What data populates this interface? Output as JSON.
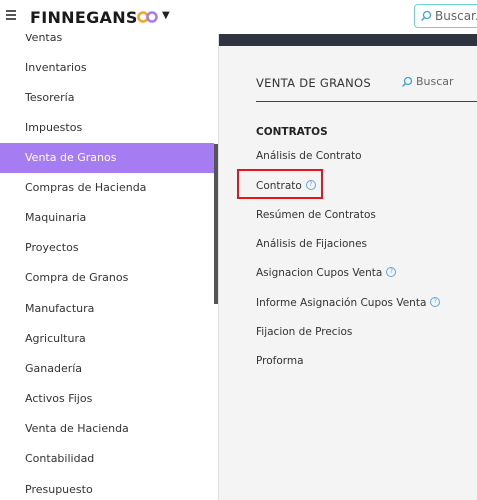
{
  "header": {
    "brand": "FINNEGANS",
    "search_placeholder": "Buscar..."
  },
  "sidebar": {
    "items": [
      {
        "label": "Ventas"
      },
      {
        "label": "Inventarios"
      },
      {
        "label": "Tesorería"
      },
      {
        "label": "Impuestos"
      },
      {
        "label": "Venta de Granos",
        "active": true
      },
      {
        "label": "Compras de Hacienda"
      },
      {
        "label": "Maquinaria"
      },
      {
        "label": "Proyectos"
      },
      {
        "label": "Compra de Granos"
      },
      {
        "label": "Manufactura"
      },
      {
        "label": "Agricultura"
      },
      {
        "label": "Ganadería"
      },
      {
        "label": "Activos Fijos"
      },
      {
        "label": "Venta de Hacienda"
      },
      {
        "label": "Contabilidad"
      },
      {
        "label": "Presupuesto"
      }
    ]
  },
  "main": {
    "title": "VENTA DE GRANOS",
    "search_label": "Buscar",
    "section": "CONTRATOS",
    "links": [
      {
        "label": "Análisis de Contrato",
        "help": false
      },
      {
        "label": "Contrato",
        "help": true
      },
      {
        "label": "Resúmen de Contratos",
        "help": false
      },
      {
        "label": "Análisis de Fijaciones",
        "help": false
      },
      {
        "label": "Asignacion Cupos Venta",
        "help": true
      },
      {
        "label": "Informe Asignación Cupos Venta",
        "help": true
      },
      {
        "label": "Fijacion de Precios",
        "help": false
      },
      {
        "label": "Proforma",
        "help": false
      }
    ],
    "help_glyph": "?"
  },
  "colors": {
    "active_bg": "#a67cf3",
    "highlight": "#e8141b",
    "header_band": "#2f3440",
    "search_border": "#6fd3d3"
  }
}
